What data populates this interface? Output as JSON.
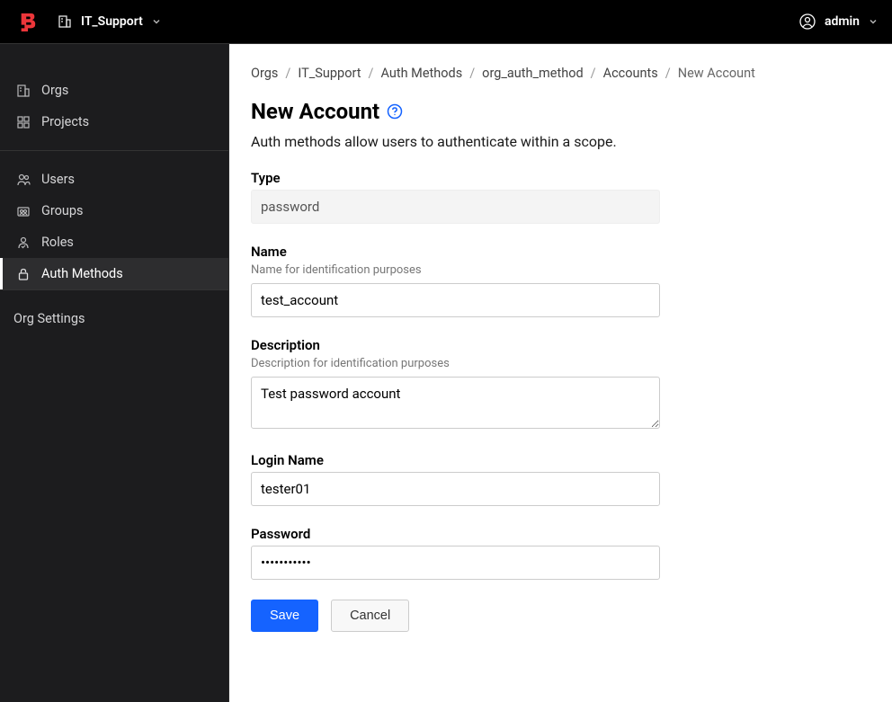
{
  "header": {
    "scope_name": "IT_Support",
    "user_name": "admin"
  },
  "sidebar": {
    "scope_items": [
      {
        "label": "Orgs",
        "icon": "org"
      },
      {
        "label": "Projects",
        "icon": "projects"
      }
    ],
    "iam_items": [
      {
        "label": "Users",
        "icon": "users"
      },
      {
        "label": "Groups",
        "icon": "groups"
      },
      {
        "label": "Roles",
        "icon": "roles"
      },
      {
        "label": "Auth Methods",
        "icon": "lock",
        "active": true
      }
    ],
    "settings_label": "Org Settings"
  },
  "breadcrumb": {
    "items": [
      "Orgs",
      "IT_Support",
      "Auth Methods",
      "org_auth_method",
      "Accounts",
      "New Account"
    ]
  },
  "page": {
    "title": "New Account",
    "description": "Auth methods allow users to authenticate within a scope."
  },
  "form": {
    "type_label": "Type",
    "type_value": "password",
    "name_label": "Name",
    "name_hint": "Name for identification purposes",
    "name_value": "test_account",
    "desc_label": "Description",
    "desc_hint": "Description for identification purposes",
    "desc_value": "Test password account",
    "login_label": "Login Name",
    "login_value": "tester01",
    "password_label": "Password",
    "password_value": "•••••••••••",
    "save_label": "Save",
    "cancel_label": "Cancel"
  }
}
